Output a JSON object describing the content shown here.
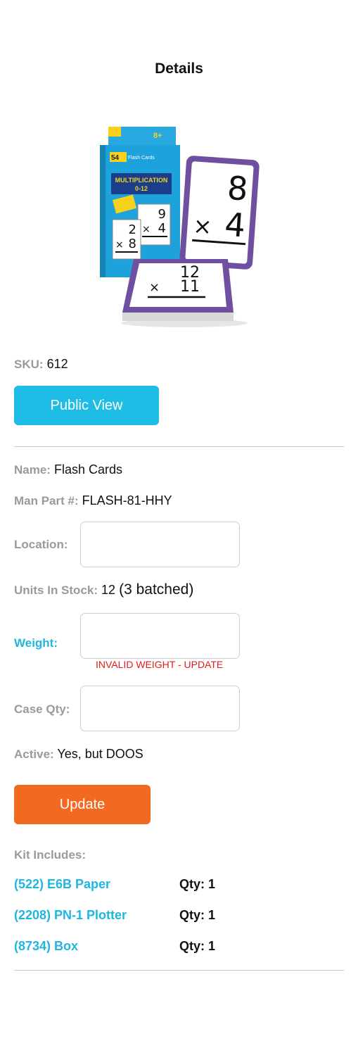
{
  "header": {
    "title": "Details"
  },
  "product": {
    "image_alt": "Multiplication 0-12 flash cards",
    "box_count": "54",
    "box_brand": "Flash Cards",
    "box_title_1": "MULTIPLICATION",
    "box_title_2": "0-12",
    "box_age": "8+",
    "card_a_top": "8",
    "card_a_bottom": "4",
    "card_b_top": "12",
    "card_b_bottom": "11",
    "card_c_top": "9",
    "card_c_bottom": "4",
    "card_d_top": "2",
    "card_d_bottom": "8",
    "times": "×"
  },
  "sku": {
    "label": "SKU:",
    "value": "612"
  },
  "public_view_button": "Public View",
  "name": {
    "label": "Name:",
    "value": "Flash Cards"
  },
  "man_part": {
    "label": "Man Part #:",
    "value": "FLASH-81-HHY"
  },
  "location": {
    "label": "Location:",
    "value": ""
  },
  "units_in_stock": {
    "label": "Units In Stock:",
    "value": "12",
    "batched": "(3 batched)"
  },
  "weight": {
    "label": "Weight:",
    "value": "",
    "error": "INVALID WEIGHT - UPDATE"
  },
  "case_qty": {
    "label": "Case Qty:",
    "value": ""
  },
  "active": {
    "label": "Active:",
    "value": "Yes, but DOOS"
  },
  "update_button": "Update",
  "kit": {
    "label": "Kit Includes:",
    "items": [
      {
        "name": "(522) E6B Paper",
        "qty": "Qty: 1"
      },
      {
        "name": "(2208) PN-1 Plotter",
        "qty": "Qty: 1"
      },
      {
        "name": "(8734) Box",
        "qty": "Qty: 1"
      }
    ]
  },
  "colors": {
    "accent": "#1fbde6",
    "update": "#f26a22",
    "error": "#e41b1b",
    "label": "#9a9a9a"
  }
}
